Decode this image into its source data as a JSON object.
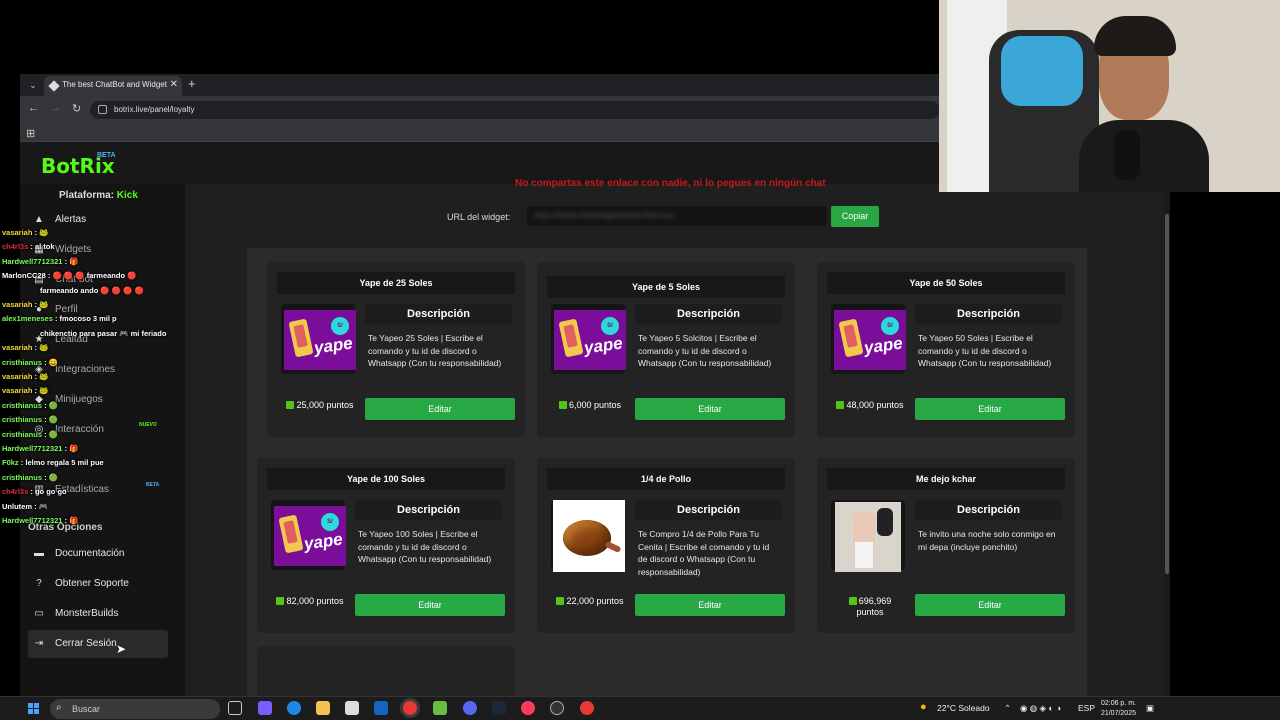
{
  "browser": {
    "tab_title": "The best ChatBot and Widgets",
    "url": "botrix.live/panel/loyalty"
  },
  "brand": {
    "logo": "BotRix",
    "beta": "BETA"
  },
  "warning": "No compartas este enlace con nadie, ni lo pegues en ningún chat",
  "platform": {
    "label": "Plataforma:",
    "value": "Kick"
  },
  "sidebar": {
    "items": [
      {
        "label": "Alertas"
      },
      {
        "label": "Widgets"
      },
      {
        "label": "Chat bot"
      },
      {
        "label": "Perfil"
      },
      {
        "label": "Lealtad"
      },
      {
        "label": "Integraciones"
      },
      {
        "label": "Minijuegos"
      },
      {
        "label": "Interacción",
        "badge": "NUEVO"
      },
      {
        "label": "Estadísticas",
        "badge": "BETA"
      }
    ],
    "section": "Otras Opciones",
    "other": [
      {
        "label": "Documentación"
      },
      {
        "label": "Obtener Soporte"
      },
      {
        "label": "MonsterBuilds"
      },
      {
        "label": "Cerrar Sesión"
      }
    ]
  },
  "widget": {
    "label": "URL del widget:",
    "url": "https://botrix.live/widgets/shop?bid=xxx",
    "copy": "Copiar"
  },
  "cards": [
    {
      "title": "Yape de 25 Soles",
      "desc_title": "Descripción",
      "desc": "Te Yapeo 25 Soles | Escribe el comando y tu id de discord o Whatsapp (Con tu responsabilidad)",
      "points": "25,000 puntos",
      "edit": "Editar",
      "image": "yape"
    },
    {
      "title": "Yape de 5 Soles",
      "desc_title": "Descripción",
      "desc": "Te Yapeo 5 Solcitos | Escribe el comando y tu id de discord o Whatsapp (Con tu responsabilidad)",
      "points": "6,000 puntos",
      "edit": "Editar",
      "image": "yape"
    },
    {
      "title": "Yape de 50 Soles",
      "desc_title": "Descripción",
      "desc": "Te Yapeo 50 Soles | Escribe el comando y tu id de discord o Whatsapp (Con tu responsabilidad)",
      "points": "48,000 puntos",
      "edit": "Editar",
      "image": "yape"
    },
    {
      "title": "Yape de 100 Soles",
      "desc_title": "Descripción",
      "desc": "Te Yapeo 100 Soles | Escribe el comando y tu id de discord o Whatsapp (Con tu responsabilidad)",
      "points": "82,000 puntos",
      "edit": "Editar",
      "image": "yape"
    },
    {
      "title": "1/4 de Pollo",
      "desc_title": "Descripción",
      "desc": "Te Compro 1/4 de Pollo Para Tu Cenita | Escribe el comando y tu id de discord o Whatsapp (Con tu responsabilidad)",
      "points": "22,000 puntos",
      "edit": "Editar",
      "image": "pollo"
    },
    {
      "title": "Me dejo kchar",
      "desc_title": "Descripción",
      "desc": "Te invito una noche solo conmigo en mi depa (incluye ponchito)",
      "points": "696,969 puntos",
      "edit": "Editar",
      "image": "kchar"
    }
  ],
  "yape_text": "yape",
  "yape_coin": "S/",
  "chat": [
    {
      "user": "vasariah",
      "msg": ": 🐸",
      "color": "#f5d742"
    },
    {
      "user": "ch4rl3s",
      "msg": ": al tok",
      "color": "#e03030"
    },
    {
      "user": "Hardwell7712321",
      "msg": ": 🎁",
      "color": "#7cfc5a"
    },
    {
      "user": "MarlonCC28",
      "msg": ": 🔴 🔴 🔴 farmeando 🔴",
      "color": "#ffffff"
    },
    {
      "user": "",
      "msg": "farmeando ando 🔴 🔴 🔴 🔴",
      "color": "#ffffff"
    },
    {
      "user": "vasariah",
      "msg": ": 🐸",
      "color": "#f5d742"
    },
    {
      "user": "alex1meneses",
      "msg": ": fmocoso 3 mil p",
      "color": "#7cfc5a"
    },
    {
      "user": "",
      "msg": "chikenctio para pasar 🎮 mi feriado",
      "color": "#ffffff"
    },
    {
      "user": "vasariah",
      "msg": ": 🐸",
      "color": "#f5d742"
    },
    {
      "user": "cristhianus",
      "msg": ": 😀",
      "color": "#7cfc5a"
    },
    {
      "user": "vasariah",
      "msg": ": 🐸",
      "color": "#f5d742"
    },
    {
      "user": "vasariah",
      "msg": ": 🐸",
      "color": "#f5d742"
    },
    {
      "user": "cristhianus",
      "msg": ": 🟢",
      "color": "#7cfc5a"
    },
    {
      "user": "cristhianus",
      "msg": ": 🟢",
      "color": "#7cfc5a"
    },
    {
      "user": "cristhianus",
      "msg": ": 🟢",
      "color": "#7cfc5a"
    },
    {
      "user": "Hardwell7712321",
      "msg": ": 🎁",
      "color": "#7cfc5a"
    },
    {
      "user": "F0kz",
      "msg": ": lelmo regala 5 mil pue",
      "color": "#7cfc5a"
    },
    {
      "user": "cristhianus",
      "msg": ": 🟢",
      "color": "#7cfc5a"
    },
    {
      "user": "ch4rl3s",
      "msg": ": go go go",
      "color": "#e03030"
    },
    {
      "user": "Unlutem",
      "msg": ": 🎮",
      "color": "#ffffff"
    },
    {
      "user": "Hardwell7712321",
      "msg": ": 🎁",
      "color": "#7cfc5a"
    }
  ],
  "taskbar": {
    "search": "Buscar",
    "weather": "22°C  Soleado",
    "lang": "ESP",
    "time": "02:06 p. m.",
    "date": "21/07/2025"
  },
  "colors": {
    "accent": "#28a745",
    "brand": "#53fc18",
    "warning": "#c41a1a"
  }
}
